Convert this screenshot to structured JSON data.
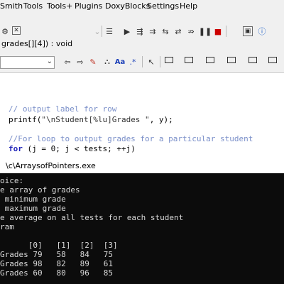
{
  "menubar": {
    "items": [
      "Smith",
      "Tools",
      "Tools+",
      "Plugins",
      "DoxyBlocks",
      "Settings",
      "Help"
    ]
  },
  "toolbar": {
    "function_selector": "grades[][4]) : void",
    "scope_selector": "",
    "row1_icons": [
      "gear-icon",
      "close-icon",
      "dropdown-icon",
      "list-icon",
      "run-icon",
      "step-icon",
      "step-into-icon",
      "step-out-icon",
      "next-icon",
      "break-icon",
      "pause-icon",
      "stop-icon",
      "window-icon",
      "info-icon"
    ],
    "row3_icons": [
      "back-icon",
      "forward-icon",
      "highlight-icon",
      "code-icon",
      "text-icon",
      "search-icon",
      "cursor-icon",
      "box-icon",
      "box-icon",
      "box-icon",
      "box-icon",
      "box-icon",
      "box-icon"
    ]
  },
  "editor": {
    "lines": [
      {
        "comment": "// output label for row"
      },
      {
        "func": "printf(",
        "str": "\"\\nStudent[%lu]Grades \"",
        "rest": ", y);"
      },
      {
        "comment": "//For loop to output grades for a particular student"
      },
      {
        "kw": "for",
        "rest": " (j = 0; j < tests; ++j)"
      }
    ]
  },
  "console": {
    "title": "\\c\\ArraysofPointers.exe",
    "lines": [
      "oice:",
      "e array of grades",
      " minimum grade",
      " maximum grade",
      "e average on all tests for each student",
      "ram",
      "",
      "      [0]   [1]  [2]  [3]",
      "Grades 79   58   84   75",
      "Grades 98   82   89   61",
      "Grades 60   80   96   85"
    ]
  }
}
